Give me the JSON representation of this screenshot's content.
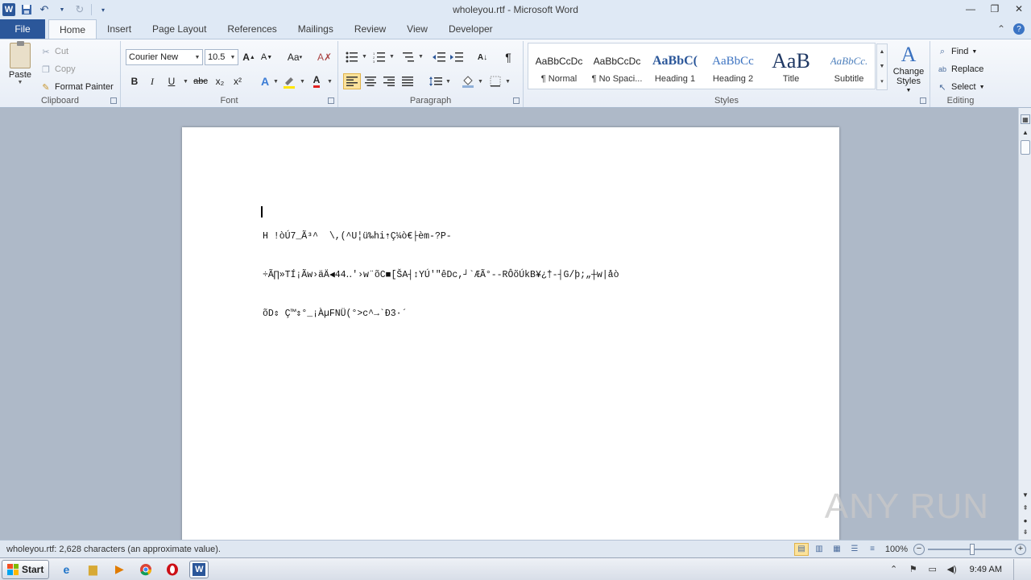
{
  "window": {
    "title": "wholeyou.rtf - Microsoft Word",
    "logo_letter": "W"
  },
  "tabs": {
    "file": "File",
    "items": [
      "Home",
      "Insert",
      "Page Layout",
      "References",
      "Mailings",
      "Review",
      "View",
      "Developer"
    ],
    "active": "Home"
  },
  "ribbon": {
    "clipboard": {
      "label": "Clipboard",
      "paste": "Paste",
      "cut": "Cut",
      "copy": "Copy",
      "format_painter": "Format Painter"
    },
    "font": {
      "label": "Font",
      "font_name": "Courier New",
      "font_size": "10.5",
      "bold": "B",
      "italic": "I",
      "underline": "U",
      "strikethrough": "abc",
      "subscript": "x₂",
      "superscript": "x²",
      "change_case": "Aa",
      "grow": "A",
      "shrink": "A"
    },
    "paragraph": {
      "label": "Paragraph",
      "pilcrow": "¶"
    },
    "styles": {
      "label": "Styles",
      "tiles": [
        {
          "preview": "AaBbCcDc",
          "name": "¶ Normal"
        },
        {
          "preview": "AaBbCcDc",
          "name": "¶ No Spaci..."
        },
        {
          "preview": "AaBbC(",
          "name": "Heading 1"
        },
        {
          "preview": "AaBbCc",
          "name": "Heading 2"
        },
        {
          "preview": "AaB",
          "name": "Title"
        },
        {
          "preview": "AaBbCc.",
          "name": "Subtitle"
        }
      ],
      "change_styles": "Change Styles"
    },
    "editing": {
      "label": "Editing",
      "find": "Find",
      "replace": "Replace",
      "select": "Select"
    }
  },
  "document": {
    "lines": [
      "H !òÚ7_Ã³^  \\,(^U¦ü‰hi⇡Ç¼ò€├èm-?P-",
      "÷Ã∏»TÍ¡Ãw›äÄ◀44‥'›w¨õC■[ŠA┤↕YÚ'″êDc,┘`ÆÃ°--RÔõÚkB¥¿†-┤G/þ;„┼w|åò",
      "õD⇕ Ç™⇕°_¡ÀµFNÜ(°>c^→`Ð3·´"
    ]
  },
  "watermark": "ANY RUN",
  "status": {
    "text": "wholeyou.rtf: 2,628 characters (an approximate value).",
    "zoom": "100%"
  },
  "taskbar": {
    "start": "Start",
    "clock": "9:49 AM"
  }
}
